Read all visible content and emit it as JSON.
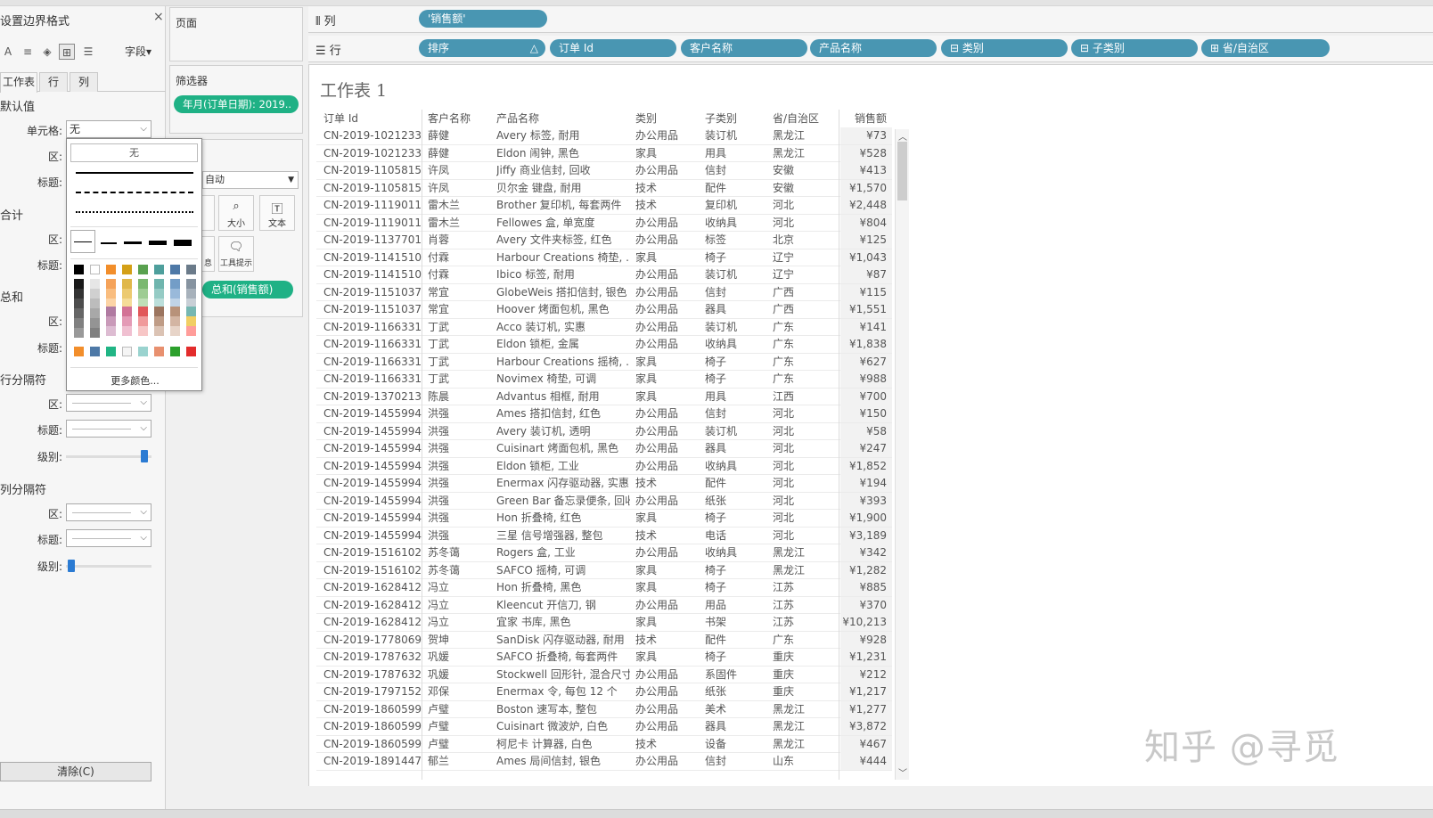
{
  "format_pane": {
    "title": "设置边界格式",
    "close": "×",
    "fields_button": "字段▾",
    "tabs": [
      "工作表",
      "行",
      "列"
    ],
    "default_section": "默认值",
    "cell_label": "单元格:",
    "cell_value": "无",
    "area_label": "区:",
    "header_label": "标题:",
    "subtotal_section": "合计",
    "total_section": "总和",
    "row_divider_section": "行分隔符",
    "col_divider_section": "列分隔符",
    "level_label": "级别:",
    "row_level": 0.95,
    "col_level": 0.02,
    "clear_button": "清除(C)"
  },
  "popup": {
    "none_label": "无",
    "more_colors": "更多颜色...",
    "palette_row1": [
      "#000000",
      "#ffffff",
      "#f28e2b",
      "#d4a017",
      "#59a14f",
      "#4e9f9c",
      "#4e79a7",
      "#6b7b8a"
    ],
    "grays": [
      "#1a1a1a",
      "#333333",
      "#4d4d4d",
      "#666666",
      "#808080",
      "#999999"
    ],
    "lights": [
      "#e6e6e6",
      "#d0d0d0",
      "#bcbcbc",
      "#a8a8a8",
      "#949494",
      "#808080"
    ],
    "col_oranges": [
      "#f5a35a",
      "#f9bd7f",
      "#fcd4a6"
    ],
    "col_yellows": [
      "#e0b84a",
      "#ecca70",
      "#f5dc98"
    ],
    "col_greens": [
      "#7ab870",
      "#9dcc93",
      "#bfdfb7"
    ],
    "col_teals": [
      "#6fb5ae",
      "#95cbc5",
      "#bcdfdb"
    ],
    "col_blues": [
      "#739dc7",
      "#99b9da",
      "#c0d4e8"
    ],
    "col_slates": [
      "#8693a0",
      "#a7b1bb",
      "#c8cfd6"
    ],
    "palette_row3": [
      "#b07aa1",
      "#d37295",
      "#e15759",
      "#9c755f",
      "#b8927a",
      "#76b7b2"
    ],
    "palette_row3b": [
      "#c99ab9",
      "#e49bb6",
      "#f09a9b",
      "#bf9c86",
      "#d3b5a3",
      "#f1ce63"
    ],
    "palette_row3c": [
      "#ddbcd2",
      "#f0c0d1",
      "#f7c6c6",
      "#dbc3b4",
      "#e7d4c8",
      "#ff9d9a"
    ],
    "recent": [
      "#f28e2b",
      "#4e79a7",
      "#21b585",
      "#f5f5f5",
      "#9ad3cf",
      "#e8906f",
      "#2ca02c",
      "#e32c2c"
    ]
  },
  "cards": {
    "pages": "页面",
    "filters": "筛选器",
    "filter_pill": "年月(订单日期): 2019..",
    "marks_type": "自动",
    "size": "大小",
    "text": "文本",
    "tooltip": "工具提示",
    "detail": "息",
    "sum_pill": "总和(销售额)"
  },
  "shelves": {
    "columns_label": "列",
    "rows_label": "行",
    "column_pills": [
      "'销售额'"
    ],
    "row_pills": [
      "排序",
      "订单 Id",
      "客户名称",
      "产品名称",
      "⊟ 类别",
      "⊟ 子类别",
      "⊞ 省/自治区"
    ]
  },
  "sheet": {
    "title": "工作表 1",
    "headers": [
      "订单 Id",
      "客户名称",
      "产品名称",
      "类别",
      "子类别",
      "省/自治区",
      "销售额"
    ]
  },
  "rows": [
    [
      "CN-2019-1021233",
      "薛健",
      "Avery 标签, 耐用",
      "办公用品",
      "装订机",
      "黑龙江",
      "¥73"
    ],
    [
      "CN-2019-1021233",
      "薛健",
      "Eldon 闹钟, 黑色",
      "家具",
      "用具",
      "黑龙江",
      "¥528"
    ],
    [
      "CN-2019-1105815",
      "许凤",
      "Jiffy 商业信封, 回收",
      "办公用品",
      "信封",
      "安徽",
      "¥413"
    ],
    [
      "CN-2019-1105815",
      "许凤",
      "贝尔金 键盘, 耐用",
      "技术",
      "配件",
      "安徽",
      "¥1,570"
    ],
    [
      "CN-2019-1119011",
      "雷木兰",
      "Brother 复印机, 每套两件",
      "技术",
      "复印机",
      "河北",
      "¥2,448"
    ],
    [
      "CN-2019-1119011",
      "雷木兰",
      "Fellowes 盒, 单宽度",
      "办公用品",
      "收纳具",
      "河北",
      "¥804"
    ],
    [
      "CN-2019-1137701",
      "肖蓉",
      "Avery 文件夹标签, 红色",
      "办公用品",
      "标签",
      "北京",
      "¥125"
    ],
    [
      "CN-2019-1141510",
      "付霖",
      "Harbour Creations 椅垫, ..",
      "家具",
      "椅子",
      "辽宁",
      "¥1,043"
    ],
    [
      "CN-2019-1141510",
      "付霖",
      "Ibico 标签, 耐用",
      "办公用品",
      "装订机",
      "辽宁",
      "¥87"
    ],
    [
      "CN-2019-1151037",
      "常宜",
      "GlobeWeis 搭扣信封, 银色",
      "办公用品",
      "信封",
      "广西",
      "¥115"
    ],
    [
      "CN-2019-1151037",
      "常宜",
      "Hoover 烤面包机, 黑色",
      "办公用品",
      "器具",
      "广西",
      "¥1,551"
    ],
    [
      "CN-2019-1166331",
      "丁武",
      "Acco 装订机, 实惠",
      "办公用品",
      "装订机",
      "广东",
      "¥141"
    ],
    [
      "CN-2019-1166331",
      "丁武",
      "Eldon 锁柜, 金属",
      "办公用品",
      "收纳具",
      "广东",
      "¥1,838"
    ],
    [
      "CN-2019-1166331",
      "丁武",
      "Harbour Creations 摇椅, ..",
      "家具",
      "椅子",
      "广东",
      "¥627"
    ],
    [
      "CN-2019-1166331",
      "丁武",
      "Novimex 椅垫, 可调",
      "家具",
      "椅子",
      "广东",
      "¥988"
    ],
    [
      "CN-2019-1370213",
      "陈晨",
      "Advantus 相框, 耐用",
      "家具",
      "用具",
      "江西",
      "¥700"
    ],
    [
      "CN-2019-1455994",
      "洪强",
      "Ames 搭扣信封, 红色",
      "办公用品",
      "信封",
      "河北",
      "¥150"
    ],
    [
      "CN-2019-1455994",
      "洪强",
      "Avery 装订机, 透明",
      "办公用品",
      "装订机",
      "河北",
      "¥58"
    ],
    [
      "CN-2019-1455994",
      "洪强",
      "Cuisinart 烤面包机, 黑色",
      "办公用品",
      "器具",
      "河北",
      "¥247"
    ],
    [
      "CN-2019-1455994",
      "洪强",
      "Eldon 锁柜, 工业",
      "办公用品",
      "收纳具",
      "河北",
      "¥1,852"
    ],
    [
      "CN-2019-1455994",
      "洪强",
      "Enermax 闪存驱动器, 实惠",
      "技术",
      "配件",
      "河北",
      "¥194"
    ],
    [
      "CN-2019-1455994",
      "洪强",
      "Green Bar 备忘录便条, 回收",
      "办公用品",
      "纸张",
      "河北",
      "¥393"
    ],
    [
      "CN-2019-1455994",
      "洪强",
      "Hon 折叠椅, 红色",
      "家具",
      "椅子",
      "河北",
      "¥1,900"
    ],
    [
      "CN-2019-1455994",
      "洪强",
      "三星 信号增强器, 整包",
      "技术",
      "电话",
      "河北",
      "¥3,189"
    ],
    [
      "CN-2019-1516102",
      "苏冬蔼",
      "Rogers 盒, 工业",
      "办公用品",
      "收纳具",
      "黑龙江",
      "¥342"
    ],
    [
      "CN-2019-1516102",
      "苏冬蔼",
      "SAFCO 摇椅, 可调",
      "家具",
      "椅子",
      "黑龙江",
      "¥1,282"
    ],
    [
      "CN-2019-1628412",
      "冯立",
      "Hon 折叠椅, 黑色",
      "家具",
      "椅子",
      "江苏",
      "¥885"
    ],
    [
      "CN-2019-1628412",
      "冯立",
      "Kleencut 开信刀, 钢",
      "办公用品",
      "用品",
      "江苏",
      "¥370"
    ],
    [
      "CN-2019-1628412",
      "冯立",
      "宜家 书库, 黑色",
      "家具",
      "书架",
      "江苏",
      "¥10,213"
    ],
    [
      "CN-2019-1778069",
      "贺坤",
      "SanDisk 闪存驱动器, 耐用",
      "技术",
      "配件",
      "广东",
      "¥928"
    ],
    [
      "CN-2019-1787632",
      "巩媛",
      "SAFCO 折叠椅, 每套两件",
      "家具",
      "椅子",
      "重庆",
      "¥1,231"
    ],
    [
      "CN-2019-1787632",
      "巩媛",
      "Stockwell 回形针, 混合尺寸",
      "办公用品",
      "系固件",
      "重庆",
      "¥212"
    ],
    [
      "CN-2019-1797152",
      "邓保",
      "Enermax 令, 每包 12 个",
      "办公用品",
      "纸张",
      "重庆",
      "¥1,217"
    ],
    [
      "CN-2019-1860599",
      "卢璧",
      "Boston 速写本, 整包",
      "办公用品",
      "美术",
      "黑龙江",
      "¥1,277"
    ],
    [
      "CN-2019-1860599",
      "卢璧",
      "Cuisinart 微波炉, 白色",
      "办公用品",
      "器具",
      "黑龙江",
      "¥3,872"
    ],
    [
      "CN-2019-1860599",
      "卢璧",
      "柯尼卡 计算器, 白色",
      "技术",
      "设备",
      "黑龙江",
      "¥467"
    ],
    [
      "CN-2019-1891447",
      "郁兰",
      "Ames 局间信封, 银色",
      "办公用品",
      "信封",
      "山东",
      "¥444"
    ]
  ],
  "watermark": "知乎 @寻觅"
}
